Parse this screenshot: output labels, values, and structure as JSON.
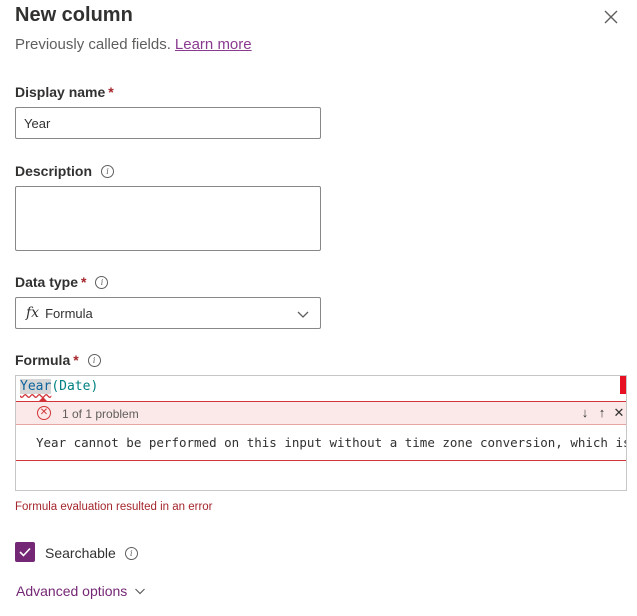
{
  "panel": {
    "title": "New column",
    "subtitle": "Previously called fields.",
    "learn_more": "Learn more"
  },
  "display_name": {
    "label": "Display name",
    "required": "*",
    "value": "Year"
  },
  "description": {
    "label": "Description",
    "value": ""
  },
  "data_type": {
    "label": "Data type",
    "required": "*",
    "icon_text": "fx",
    "value": "Formula"
  },
  "formula": {
    "label": "Formula",
    "required": "*",
    "code_function": "Year",
    "code_rest": "(Date)",
    "problem_count": "1 of 1 problem",
    "error_message": "Year cannot be performed on this input without a time zone conversion, which is not supported",
    "nav_down": "↓",
    "nav_up": "↑",
    "nav_close": "✕"
  },
  "evaluation_error": "Formula evaluation resulted in an error",
  "searchable": {
    "label": "Searchable",
    "checked": true
  },
  "advanced_options": "Advanced options",
  "colors": {
    "accent": "#742774",
    "error": "#d13438",
    "link": "#8a3a8f"
  }
}
